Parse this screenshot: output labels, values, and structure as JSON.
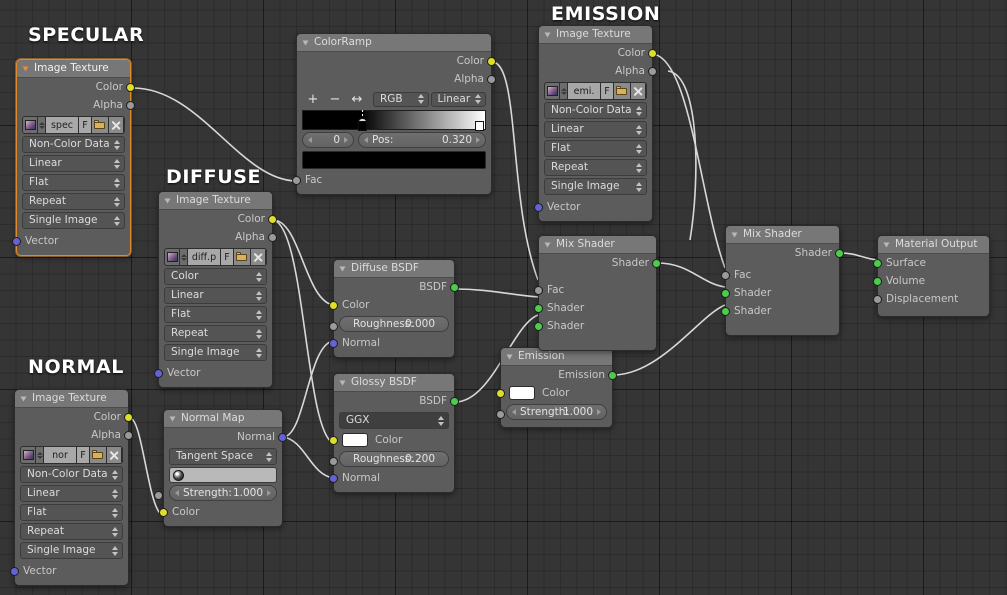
{
  "editor": {
    "background_color": "#353535",
    "grid_color": "#2b2b2b"
  },
  "section_labels": [
    {
      "id": "specular",
      "text": "SPECULAR"
    },
    {
      "id": "diffuse",
      "text": "DIFFUSE"
    },
    {
      "id": "normal",
      "text": "NORMAL"
    },
    {
      "id": "emission",
      "text": "EMISSION"
    }
  ],
  "socket_colors": {
    "color": "#dede28",
    "alpha": "#9a9a9a",
    "vector": "#6363d8",
    "shader": "#4ccc4c"
  },
  "nodes": {
    "tex_specular": {
      "title": "Image Texture",
      "outputs": [
        "Color",
        "Alpha"
      ],
      "image": {
        "name": "spec",
        "fake_user": "F"
      },
      "colorspace": "Non-Color Data",
      "interpolation": "Linear",
      "projection": "Flat",
      "extension": "Repeat",
      "source": "Single Image",
      "inputs": [
        "Vector"
      ],
      "selected": true
    },
    "tex_diffuse": {
      "title": "Image Texture",
      "outputs": [
        "Color",
        "Alpha"
      ],
      "image": {
        "name": "diff.p",
        "fake_user": "F"
      },
      "colorspace": "Color",
      "interpolation": "Linear",
      "projection": "Flat",
      "extension": "Repeat",
      "source": "Single Image",
      "inputs": [
        "Vector"
      ],
      "selected": false
    },
    "tex_normal": {
      "title": "Image Texture",
      "outputs": [
        "Color",
        "Alpha"
      ],
      "image": {
        "name": "nor",
        "fake_user": "F"
      },
      "colorspace": "Non-Color Data",
      "interpolation": "Linear",
      "projection": "Flat",
      "extension": "Repeat",
      "source": "Single Image",
      "inputs": [
        "Vector"
      ],
      "selected": false
    },
    "tex_emission": {
      "title": "Image Texture",
      "outputs": [
        "Color",
        "Alpha"
      ],
      "image": {
        "name": "emi.",
        "fake_user": "F"
      },
      "colorspace": "Non-Color Data",
      "interpolation": "Linear",
      "projection": "Flat",
      "extension": "Repeat",
      "source": "Single Image",
      "inputs": [
        "Vector"
      ],
      "selected": false
    },
    "color_ramp": {
      "title": "ColorRamp",
      "outputs": [
        "Color",
        "Alpha"
      ],
      "tools": {
        "add": "+",
        "remove": "−",
        "flip": "↔"
      },
      "color_mode": "RGB",
      "interpolation": "Linear",
      "gradient": {
        "from": "#000000",
        "to": "#ffffff",
        "stop_position": 0.32
      },
      "index_value": "0",
      "pos_label": "Pos:",
      "pos_value": "0.320",
      "selected_color": "#000000",
      "inputs": [
        "Fac"
      ]
    },
    "normal_map": {
      "title": "Normal Map",
      "outputs": [
        "Normal"
      ],
      "space": "Tangent Space",
      "uv_map": "",
      "strength_label": "Strength:",
      "strength_value": "1.000",
      "inputs": [
        "Color"
      ]
    },
    "diffuse_bsdf": {
      "title": "Diffuse BSDF",
      "outputs": [
        "BSDF"
      ],
      "inputs": [
        "Color",
        "Normal"
      ],
      "roughness_label": "Roughness:",
      "roughness_value": "0.000"
    },
    "glossy_bsdf": {
      "title": "Glossy BSDF",
      "outputs": [
        "BSDF"
      ],
      "distribution": "GGX",
      "color_label": "Color",
      "color_value": "#ffffff",
      "roughness_label": "Roughness:",
      "roughness_value": "0.200",
      "inputs": [
        "Normal"
      ]
    },
    "emission": {
      "title": "Emission",
      "outputs": [
        "Emission"
      ],
      "color_label": "Color",
      "color_value": "#ffffff",
      "strength_label": "Strength:",
      "strength_value": "1.000"
    },
    "mix_shader_1": {
      "title": "Mix Shader",
      "outputs": [
        "Shader"
      ],
      "inputs": [
        "Fac",
        "Shader",
        "Shader"
      ]
    },
    "mix_shader_2": {
      "title": "Mix Shader",
      "outputs": [
        "Shader"
      ],
      "inputs": [
        "Fac",
        "Shader",
        "Shader"
      ]
    },
    "material_output": {
      "title": "Material Output",
      "inputs": [
        "Surface",
        "Volume",
        "Displacement"
      ]
    }
  }
}
